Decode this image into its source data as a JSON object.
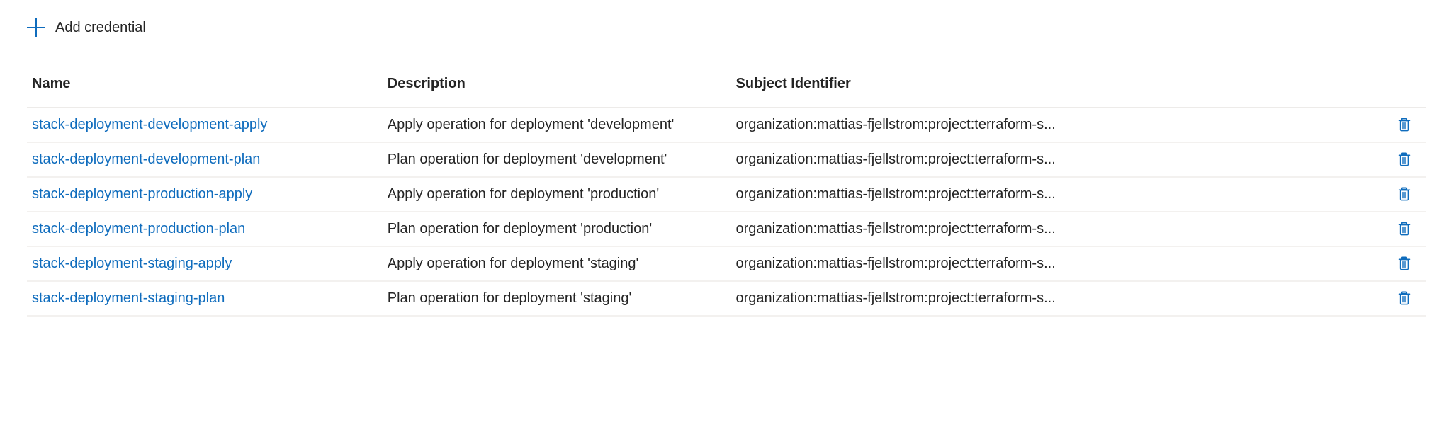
{
  "colors": {
    "link": "#0f6cbd",
    "icon_blue": "#0f6cbd",
    "text": "#242424",
    "row_border": "#f3f1ef",
    "header_border": "#edebe9",
    "background": "#ffffff"
  },
  "toolbar": {
    "add_credential_label": "Add credential",
    "add_icon": "plus-icon"
  },
  "table": {
    "columns": [
      {
        "key": "name",
        "label": "Name"
      },
      {
        "key": "description",
        "label": "Description"
      },
      {
        "key": "subject",
        "label": "Subject Identifier"
      },
      {
        "key": "actions",
        "label": ""
      }
    ],
    "rows": [
      {
        "name": "stack-deployment-development-apply",
        "description": "Apply operation for deployment 'development'",
        "subject": "organization:mattias-fjellstrom:project:terraform-s...",
        "delete_icon": "trash-icon"
      },
      {
        "name": "stack-deployment-development-plan",
        "description": "Plan operation for deployment 'development'",
        "subject": "organization:mattias-fjellstrom:project:terraform-s...",
        "delete_icon": "trash-icon"
      },
      {
        "name": "stack-deployment-production-apply",
        "description": "Apply operation for deployment 'production'",
        "subject": "organization:mattias-fjellstrom:project:terraform-s...",
        "delete_icon": "trash-icon"
      },
      {
        "name": "stack-deployment-production-plan",
        "description": "Plan operation for deployment 'production'",
        "subject": "organization:mattias-fjellstrom:project:terraform-s...",
        "delete_icon": "trash-icon"
      },
      {
        "name": "stack-deployment-staging-apply",
        "description": "Apply operation for deployment 'staging'",
        "subject": "organization:mattias-fjellstrom:project:terraform-s...",
        "delete_icon": "trash-icon"
      },
      {
        "name": "stack-deployment-staging-plan",
        "description": "Plan operation for deployment 'staging'",
        "subject": "organization:mattias-fjellstrom:project:terraform-s...",
        "delete_icon": "trash-icon"
      }
    ]
  }
}
